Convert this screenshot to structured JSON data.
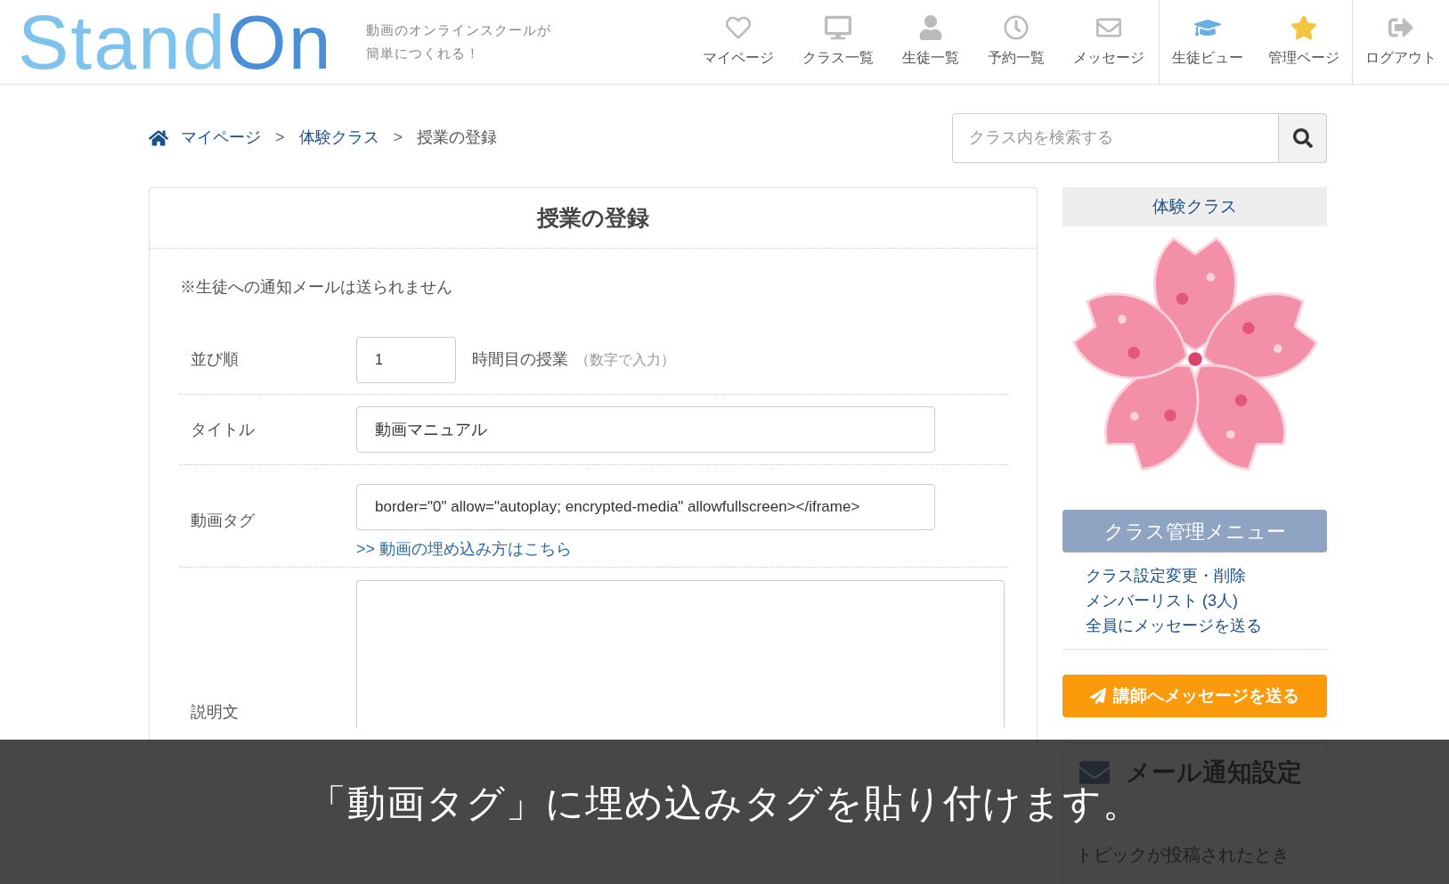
{
  "header": {
    "logo": {
      "light": "Stand",
      "dark": "On"
    },
    "tagline": [
      "動画のオンラインスクールが",
      "簡単につくれる！"
    ],
    "nav_groups": [
      [
        {
          "label": "マイページ"
        },
        {
          "label": "クラス一覧"
        },
        {
          "label": "生徒一覧"
        },
        {
          "label": "予約一覧"
        },
        {
          "label": "メッセージ"
        }
      ],
      [
        {
          "label": "生徒ビュー"
        },
        {
          "label": "管理ページ"
        }
      ],
      [
        {
          "label": "ログアウト"
        }
      ]
    ]
  },
  "breadcrumb": [
    {
      "label": "マイページ",
      "link": true
    },
    {
      "label": "体験クラス",
      "link": true
    },
    {
      "label": "授業の登録",
      "link": false
    }
  ],
  "breadcrumb_separator": ">",
  "search": {
    "placeholder": "クラス内を検索する"
  },
  "form": {
    "title": "授業の登録",
    "note": "※生徒への通知メールは送られません",
    "rows": [
      {
        "kind": "order",
        "label": "並び順",
        "value": "1",
        "suffix": "時間目の授業",
        "hint": "（数字で入力）"
      },
      {
        "kind": "text",
        "label": "タイトル",
        "value": "動画マニュアル"
      },
      {
        "kind": "tag",
        "label": "動画タグ",
        "value": "border=\"0\" allow=\"autoplay; encrypted-media\" allowfullscreen></iframe>",
        "link": ">> 動画の埋め込み方はこちら"
      },
      {
        "kind": "textarea",
        "label": "説明文"
      }
    ]
  },
  "sidebar": {
    "class_name": "体験クラス",
    "menu_title": "クラス管理メニュー",
    "menu_links": [
      "クラス設定変更・削除",
      "メンバーリスト (3人)",
      "全員にメッセージを送る"
    ],
    "message_button": "講師へメッセージを送る",
    "mail_settings": {
      "title": "メール通知設定",
      "subtitle": "トピックが投稿されたとき"
    }
  },
  "caption": "「動画タグ」に埋め込みタグを貼り付けます。"
}
